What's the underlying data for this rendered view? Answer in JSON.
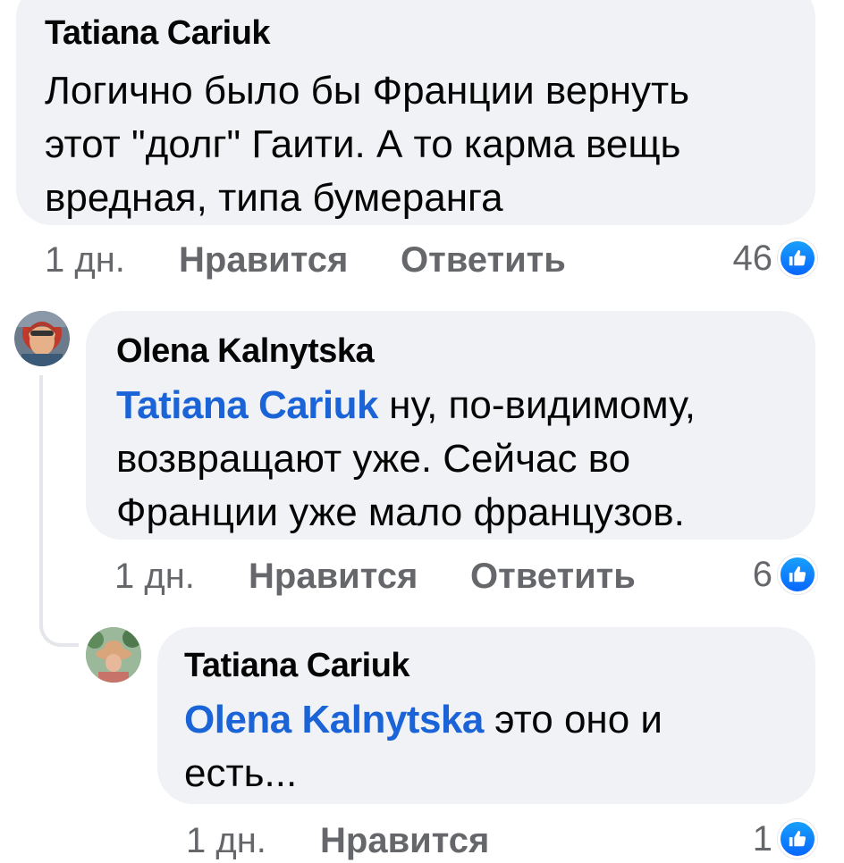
{
  "comments": [
    {
      "author": "Tatiana Cariuk",
      "text_lines": [
        "Логично было бы Франции вернуть",
        "этот \"долг\" Гаити. А то карма вещь",
        "вредная, типа бумеранга"
      ],
      "time": "1 дн.",
      "like_label": "Нравится",
      "reply_label": "Ответить",
      "reaction_count": "46"
    },
    {
      "author": "Olena Kalnytska",
      "mention": "Tatiana Cariuk",
      "text_first": " ну, по-видимому,",
      "text_lines": [
        "возвращают уже. Сейчас во",
        "Франции уже мало французов."
      ],
      "time": "1 дн.",
      "like_label": "Нравится",
      "reply_label": "Ответить",
      "reaction_count": "6"
    },
    {
      "author": "Tatiana Cariuk",
      "mention": "Olena Kalnytska",
      "text_first": " это оно и",
      "text_lines": [
        "есть..."
      ],
      "time": "1 дн.",
      "like_label": "Нравится",
      "reaction_count": "1"
    }
  ],
  "colors": {
    "bubble": "#f0f2f5",
    "mention": "#1b64d8",
    "meta": "#65676b",
    "like": "#0866ff"
  },
  "icons": [
    "thumbs-up-icon"
  ]
}
